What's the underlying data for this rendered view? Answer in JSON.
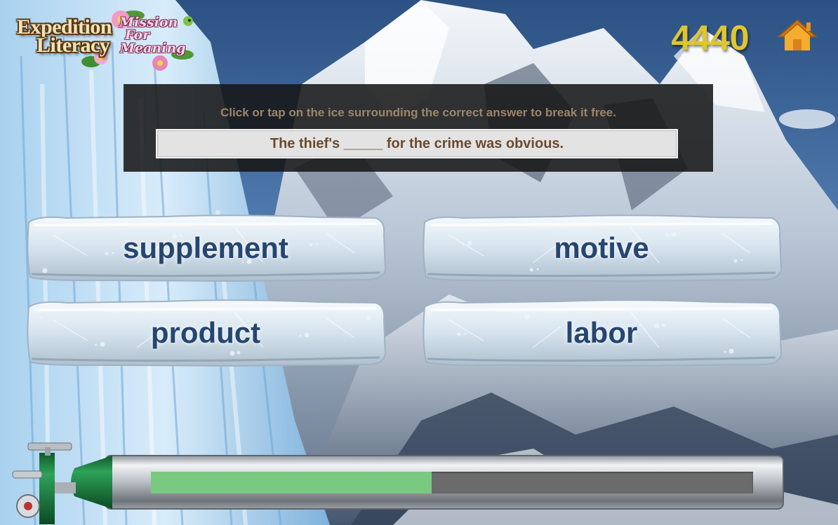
{
  "logo": {
    "line1": "Expedition",
    "line2": "Literacy",
    "script1": "Mission",
    "script2": "For",
    "script3": "Meaning"
  },
  "score": "4440",
  "home_icon": "home-icon",
  "instruction": "Click or tap on the ice surrounding the correct answer to break it free.",
  "sentence": "The thief's _____ for the crime was obvious.",
  "answers": [
    {
      "label": "supplement"
    },
    {
      "label": "motive"
    },
    {
      "label": "product"
    },
    {
      "label": "labor"
    }
  ],
  "oxygen": {
    "level": 0.466
  },
  "colors": {
    "score": "#e0c62e",
    "home": "#f0a020",
    "answer_text": "#26466f",
    "instruction": "#9f8569",
    "sentence": "#6b4a2d",
    "progress_fill": "#79c981",
    "progress_track": "#6b6b6b",
    "tank_valve": "#1f8a44"
  }
}
